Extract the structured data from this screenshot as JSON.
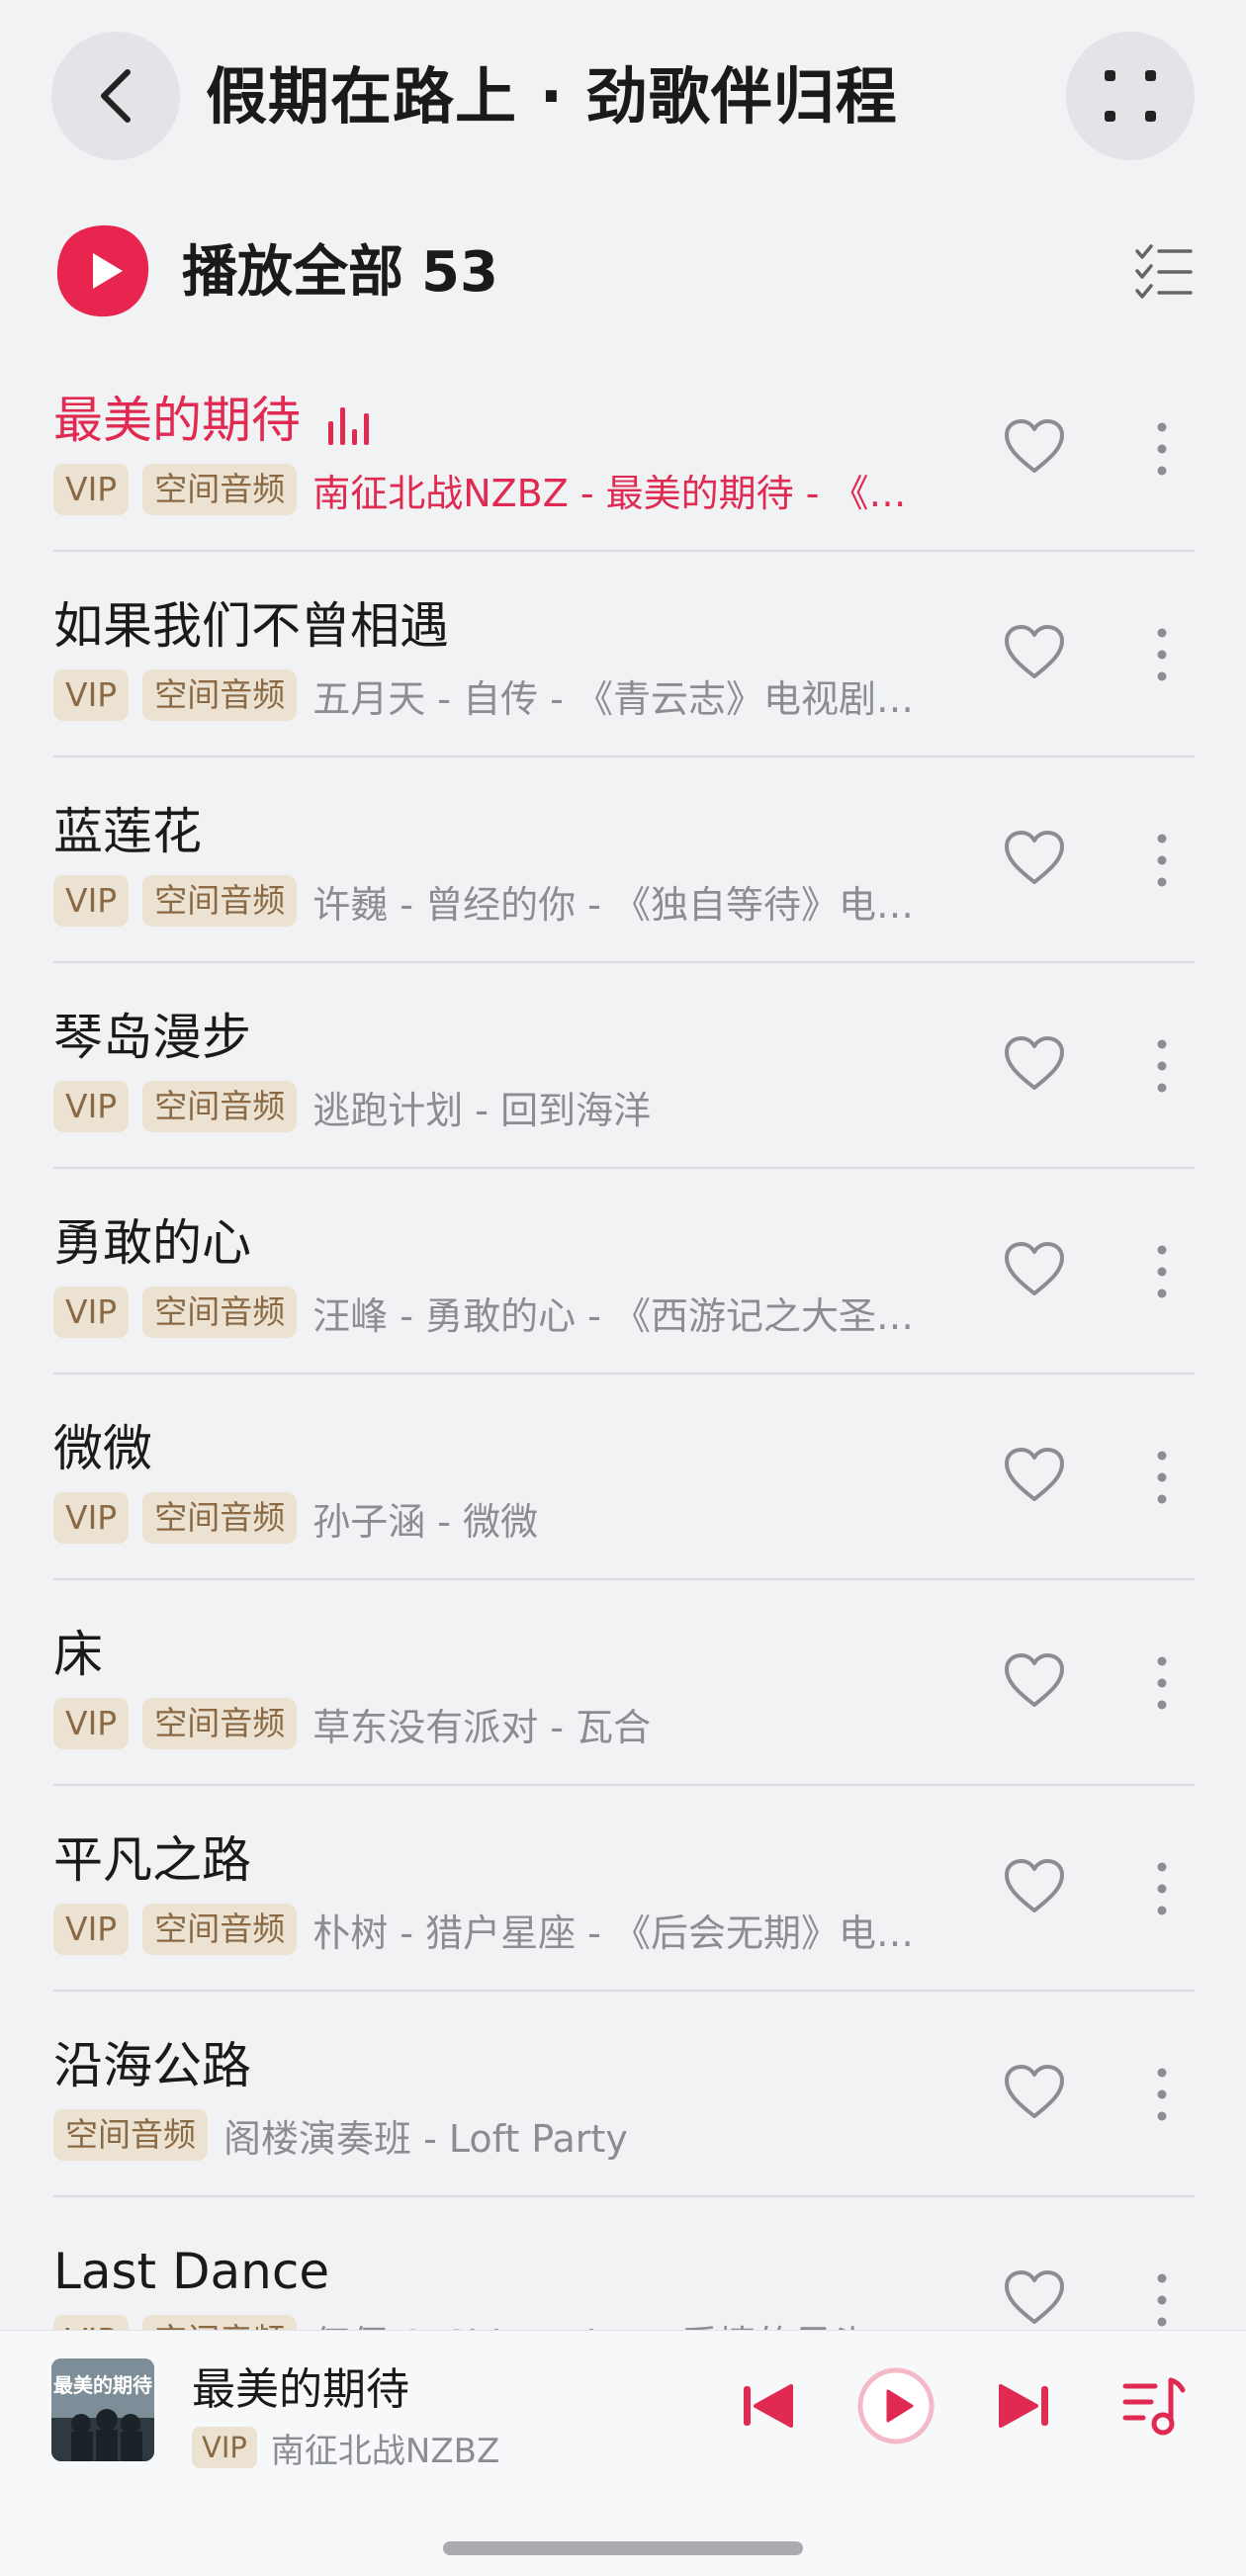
{
  "header": {
    "title": "假期在路上 · 劲歌伴归程",
    "back_icon": "chevron-left-icon",
    "more_icon": "grid-dots-icon"
  },
  "play_all": {
    "label": "播放全部",
    "count": "53",
    "icon": "play-circle-icon",
    "select_icon": "multi-select-list-icon"
  },
  "colors": {
    "accent": "#e02a52",
    "tag_bg": "#ece2d2",
    "tag_text": "#8a6a45",
    "subtitle_text": "#8b8d92"
  },
  "songs": [
    {
      "title": "最美的期待",
      "tags": [
        "VIP",
        "空间音频"
      ],
      "subtitle": "南征北战NZBZ - 最美的期待 - 《…",
      "playing": true
    },
    {
      "title": "如果我们不曾相遇",
      "tags": [
        "VIP",
        "空间音频"
      ],
      "subtitle": "五月天 - 自传 - 《青云志》电视剧…",
      "playing": false
    },
    {
      "title": "蓝莲花",
      "tags": [
        "VIP",
        "空间音频"
      ],
      "subtitle": "许巍 - 曾经的你 - 《独自等待》电…",
      "playing": false
    },
    {
      "title": "琴岛漫步",
      "tags": [
        "VIP",
        "空间音频"
      ],
      "subtitle": "逃跑计划 - 回到海洋",
      "playing": false
    },
    {
      "title": "勇敢的心",
      "tags": [
        "VIP",
        "空间音频"
      ],
      "subtitle": "汪峰 - 勇敢的心 - 《西游记之大圣…",
      "playing": false
    },
    {
      "title": "微微",
      "tags": [
        "VIP",
        "空间音频"
      ],
      "subtitle": "孙子涵 - 微微",
      "playing": false
    },
    {
      "title": "床",
      "tags": [
        "VIP",
        "空间音频"
      ],
      "subtitle": "草东没有派对 - 瓦合",
      "playing": false
    },
    {
      "title": "平凡之路",
      "tags": [
        "VIP",
        "空间音频"
      ],
      "subtitle": "朴树 - 猎户星座 - 《后会无期》电…",
      "playing": false
    },
    {
      "title": "沿海公路",
      "tags": [
        "空间音频"
      ],
      "subtitle": "阁楼演奏班 - Loft Party",
      "playing": false
    },
    {
      "title": "Last Dance",
      "tags": [
        "VIP",
        "空间音频"
      ],
      "subtitle": "伍佰 & China Blue - 爱情的尽头",
      "playing": false
    }
  ],
  "now_playing": {
    "title": "最美的期待",
    "tag": "VIP",
    "artist": "南征北战NZBZ",
    "cover_text": "最美的期待",
    "icons": [
      "skip-previous-icon",
      "play-icon",
      "skip-next-icon",
      "playlist-queue-icon"
    ]
  }
}
